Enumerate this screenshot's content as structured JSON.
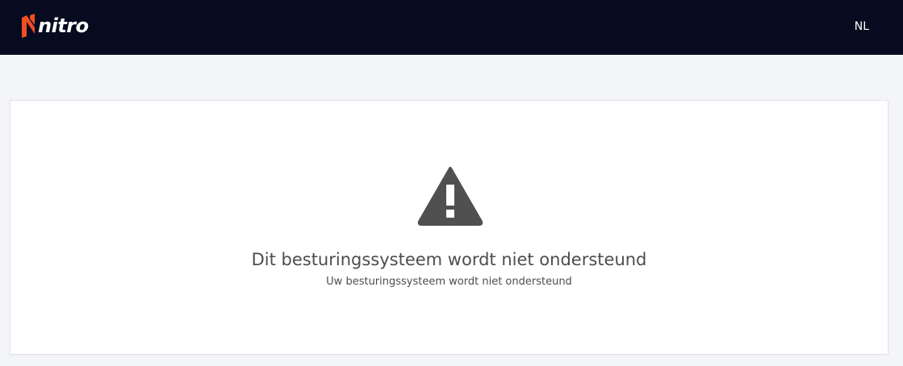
{
  "header": {
    "logo_text": "nitro",
    "language": "NL"
  },
  "message": {
    "icon": "warning-triangle-icon",
    "title": "Dit besturingssysteem wordt niet ondersteund",
    "subtitle": "Uw besturingssysteem wordt niet ondersteund"
  },
  "colors": {
    "header_bg": "#070b1f",
    "brand_orange": "#f04e23",
    "page_bg": "#f4f5f9",
    "icon_gray": "#505050"
  }
}
